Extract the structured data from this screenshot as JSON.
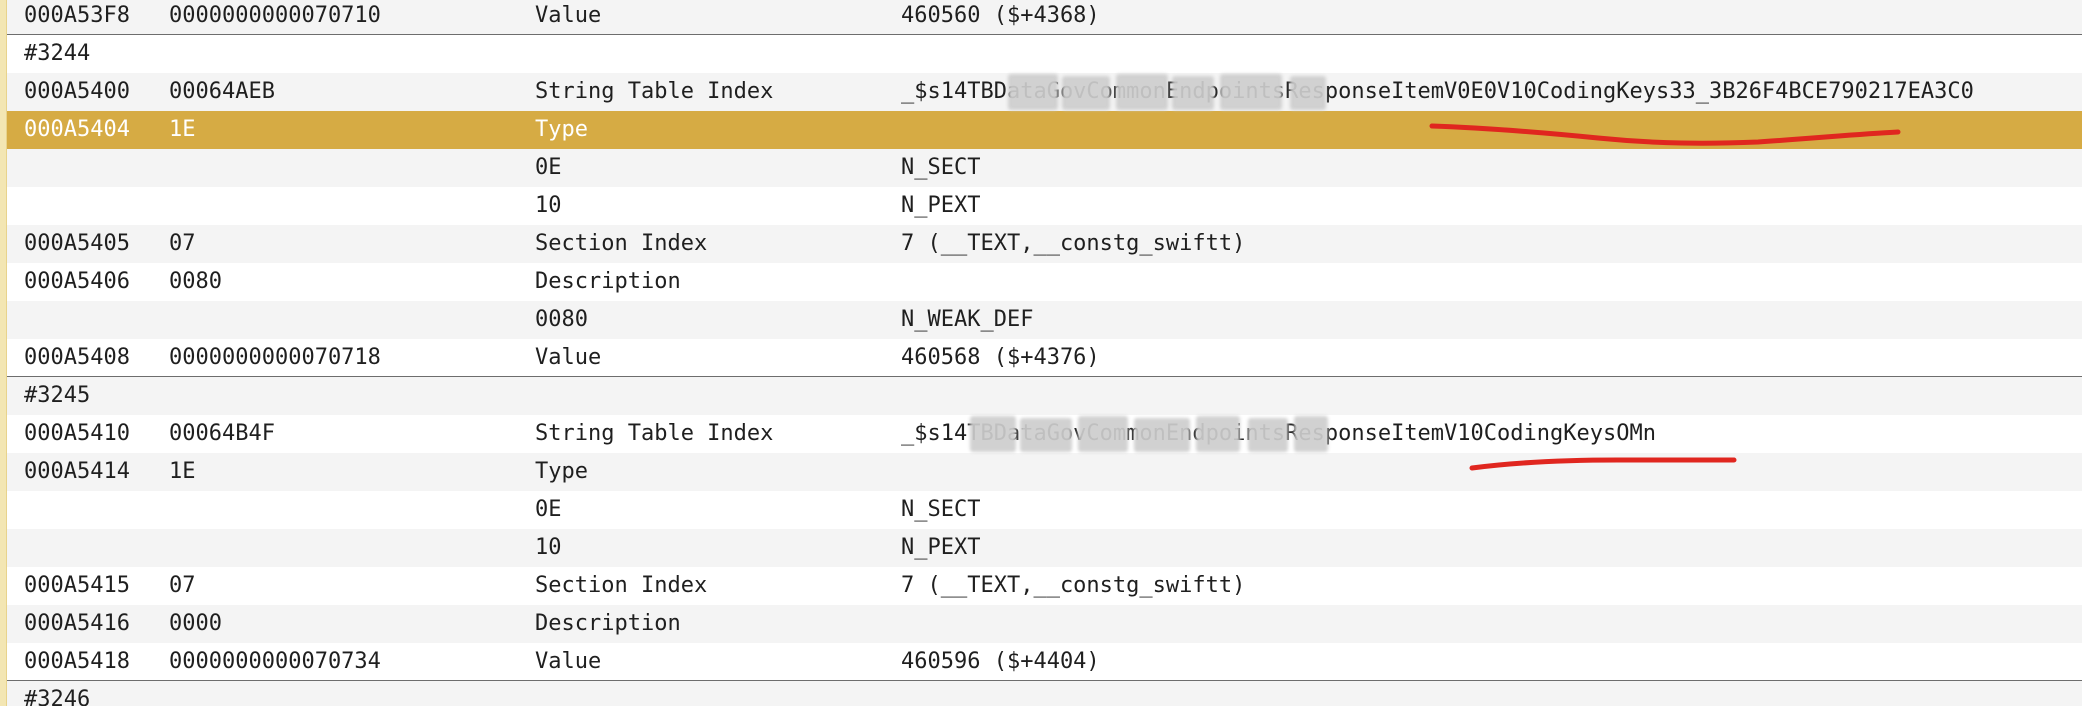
{
  "rows": [
    {
      "offset": "000A53F8",
      "data": "0000000000070710",
      "description": "Value",
      "value": "460560 ($+4368)"
    },
    {
      "symbol": "#3244"
    },
    {
      "offset": "000A5400",
      "data": "00064AEB",
      "description": "String Table Index",
      "value": "_$s14TBDataGovCommonEndpointsResponseItemV0E0V10CodingKeys33_3B26F4BCE790217EA3C0"
    },
    {
      "offset": "000A5404",
      "data": "1E",
      "description": "Type",
      "value": ""
    },
    {
      "offset": "",
      "data": "",
      "description": "0E",
      "value": "N_SECT"
    },
    {
      "offset": "",
      "data": "",
      "description": "10",
      "value": "N_PEXT"
    },
    {
      "offset": "000A5405",
      "data": "07",
      "description": "Section Index",
      "value": "7 (__TEXT,__constg_swiftt)"
    },
    {
      "offset": "000A5406",
      "data": "0080",
      "description": "Description",
      "value": ""
    },
    {
      "offset": "",
      "data": "",
      "description": "0080",
      "value": "N_WEAK_DEF"
    },
    {
      "offset": "000A5408",
      "data": "0000000000070718",
      "description": "Value",
      "value": "460568 ($+4376)"
    },
    {
      "symbol": "#3245"
    },
    {
      "offset": "000A5410",
      "data": "00064B4F",
      "description": "String Table Index",
      "value": "_$s14TBDataGovCommonEndpointsResponseItemV10CodingKeysOMn"
    },
    {
      "offset": "000A5414",
      "data": "1E",
      "description": "Type",
      "value": ""
    },
    {
      "offset": "",
      "data": "",
      "description": "0E",
      "value": "N_SECT"
    },
    {
      "offset": "",
      "data": "",
      "description": "10",
      "value": "N_PEXT"
    },
    {
      "offset": "000A5415",
      "data": "07",
      "description": "Section Index",
      "value": "7 (__TEXT,__constg_swiftt)"
    },
    {
      "offset": "000A5416",
      "data": "0000",
      "description": "Description",
      "value": ""
    },
    {
      "offset": "000A5418",
      "data": "0000000000070734",
      "description": "Value",
      "value": "460596 ($+4404)"
    },
    {
      "symbol": "#3246"
    }
  ],
  "colors": {
    "selection": "#d6ab44",
    "alt_row": "#f4f4f4",
    "annotation": "#e0261f"
  }
}
